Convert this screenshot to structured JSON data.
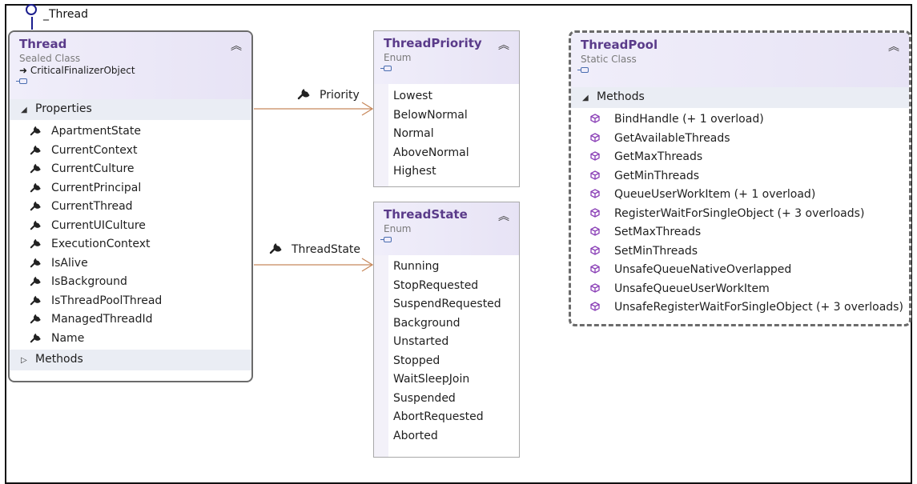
{
  "interface_lollipop": {
    "label": "_Thread"
  },
  "thread_class": {
    "title": "Thread",
    "kind": "Sealed Class",
    "base": "CriticalFinalizerObject",
    "properties_header": "Properties",
    "properties": [
      "ApartmentState",
      "CurrentContext",
      "CurrentCulture",
      "CurrentPrincipal",
      "CurrentThread",
      "CurrentUICulture",
      "ExecutionContext",
      "IsAlive",
      "IsBackground",
      "IsThreadPoolThread",
      "ManagedThreadId",
      "Name"
    ],
    "methods_header": "Methods"
  },
  "thread_priority_enum": {
    "title": "ThreadPriority",
    "kind": "Enum",
    "values": [
      "Lowest",
      "BelowNormal",
      "Normal",
      "AboveNormal",
      "Highest"
    ]
  },
  "thread_state_enum": {
    "title": "ThreadState",
    "kind": "Enum",
    "values": [
      "Running",
      "StopRequested",
      "SuspendRequested",
      "Background",
      "Unstarted",
      "Stopped",
      "WaitSleepJoin",
      "Suspended",
      "AbortRequested",
      "Aborted"
    ]
  },
  "thread_pool_class": {
    "title": "ThreadPool",
    "kind": "Static Class",
    "methods_header": "Methods",
    "methods": [
      "BindHandle (+ 1 overload)",
      "GetAvailableThreads",
      "GetMaxThreads",
      "GetMinThreads",
      "QueueUserWorkItem (+ 1 overload)",
      "RegisterWaitForSingleObject (+ 3 overloads)",
      "SetMaxThreads",
      "SetMinThreads",
      "UnsafeQueueNativeOverlapped",
      "UnsafeQueueUserWorkItem",
      "UnsafeRegisterWaitForSingleObject (+ 3 overloads)"
    ]
  },
  "associations": {
    "priority_label": "Priority",
    "state_label": "ThreadState"
  },
  "icons": {
    "property": "wrench-icon",
    "method": "method-cube-icon",
    "collapse": "chevron-up-icon"
  },
  "colors": {
    "title": "#5a3b8a",
    "association": "#c8895c",
    "interface": "#1b1e8e",
    "method_icon": "#8a3fb6"
  }
}
